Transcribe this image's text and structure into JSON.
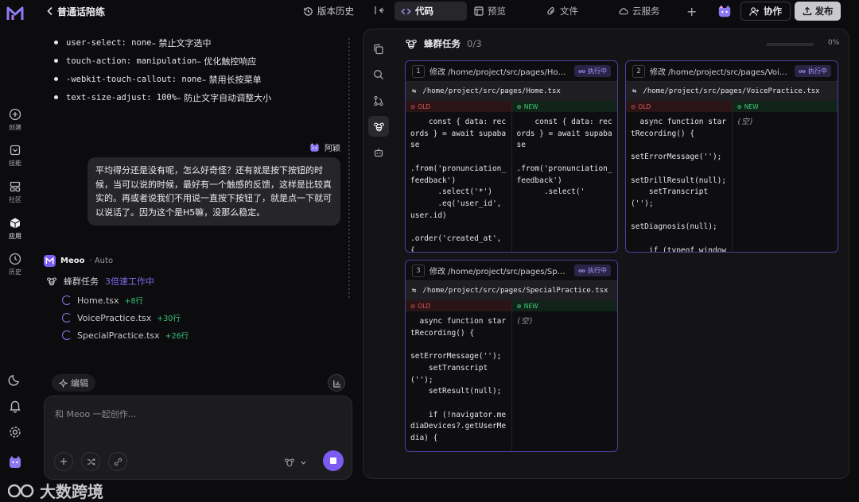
{
  "app": {
    "title": "普通话陪练"
  },
  "rail": {
    "items": [
      {
        "icon": "plus-circle-icon",
        "label": "创建"
      },
      {
        "icon": "skills-icon",
        "label": "技能"
      },
      {
        "icon": "community-icon",
        "label": "社区"
      },
      {
        "icon": "apps-icon",
        "label": "应用"
      },
      {
        "icon": "history-icon",
        "label": "历史"
      }
    ]
  },
  "header": {
    "history": "版本历史",
    "tabs": [
      {
        "label": "代码",
        "active": true
      },
      {
        "label": "预览"
      },
      {
        "label": "文件"
      },
      {
        "label": "云服务"
      }
    ],
    "collab": "协作",
    "publish": "发布"
  },
  "chat": {
    "bullets": [
      {
        "code": "user-select: none",
        "desc": " – 禁止文字选中"
      },
      {
        "code": "touch-action: manipulation",
        "desc": " – 优化触控响应"
      },
      {
        "code": "-webkit-touch-callout: none",
        "desc": " – 禁用长按菜单"
      },
      {
        "code": "text-size-adjust: 100%",
        "desc": " – 防止文字自动调整大小"
      }
    ],
    "user_name": "阿颖",
    "user_message": "平均得分还是没有呢，怎么好奇怪？还有就是按下按钮的时候，当可以说的时候，最好有一个触感的反馈，这样是比较真实的。再或者说我们不用说一直按下按钮了，就是点一下就可以说话了。因为这个是H5嘛，没那么稳定。",
    "bot_name": "Meoo",
    "bot_mode": "· Auto",
    "swarm_label": "蜂群任务",
    "swarm_speed": "3倍速工作中",
    "files": [
      {
        "name": "Home.tsx",
        "added": "+8行"
      },
      {
        "name": "VoicePractice.tsx",
        "added": "+30行"
      },
      {
        "name": "SpecialPractice.tsx",
        "added": "+26行"
      }
    ],
    "edit_chip": "编辑",
    "composer_placeholder": "和 Meoo 一起创作...",
    "watermark": "大数跨境"
  },
  "panel": {
    "title": "蜂群任务",
    "count": "0/3",
    "progress_fraction": 0,
    "progress_label": "0%",
    "old_label": "OLD",
    "new_label": "NEW",
    "cards": [
      {
        "num": "1",
        "title": "修改 /home/project/src/pages/Home.tsx",
        "badge": "执行中",
        "path": "/home/project/src/pages/Home.tsx",
        "old": "    const { data: records } = await supabase\n\n.from('pronunciation_feedback')\n      .select('*')\n      .eq('user_id', user.id)\n\n.order('created_at', {\nascending: false })",
        "new": "    const { data: records } = await supabase\n\n.from('pronunciation_feedback')\n      .select('"
      },
      {
        "num": "2",
        "title": "修改 /home/project/src/pages/VoicePractice.tsx",
        "badge": "执行中",
        "path": "/home/project/src/pages/VoicePractice.tsx",
        "old": "  async function startRecording() {\n\nsetErrorMessage('');\n\nsetDrillResult(null);\n    setTranscript('');\n\nsetDiagnosis(null);\n\n    if (typeof window\n=== 'undefined' ||",
        "new": "(空)"
      },
      {
        "num": "3",
        "title": "修改 /home/project/src/pages/SpecialPractice.tsx",
        "badge": "执行中",
        "path": "/home/project/src/pages/SpecialPractice.tsx",
        "old": "  async function startRecording() {\n\nsetErrorMessage('');\n    setTranscript('');\n    setResult(null);\n\n    if (!navigator.mediaDevices?.getUserMedia) {\n\nsetErrorMessage('当前浏",
        "new": "(空)"
      }
    ]
  }
}
